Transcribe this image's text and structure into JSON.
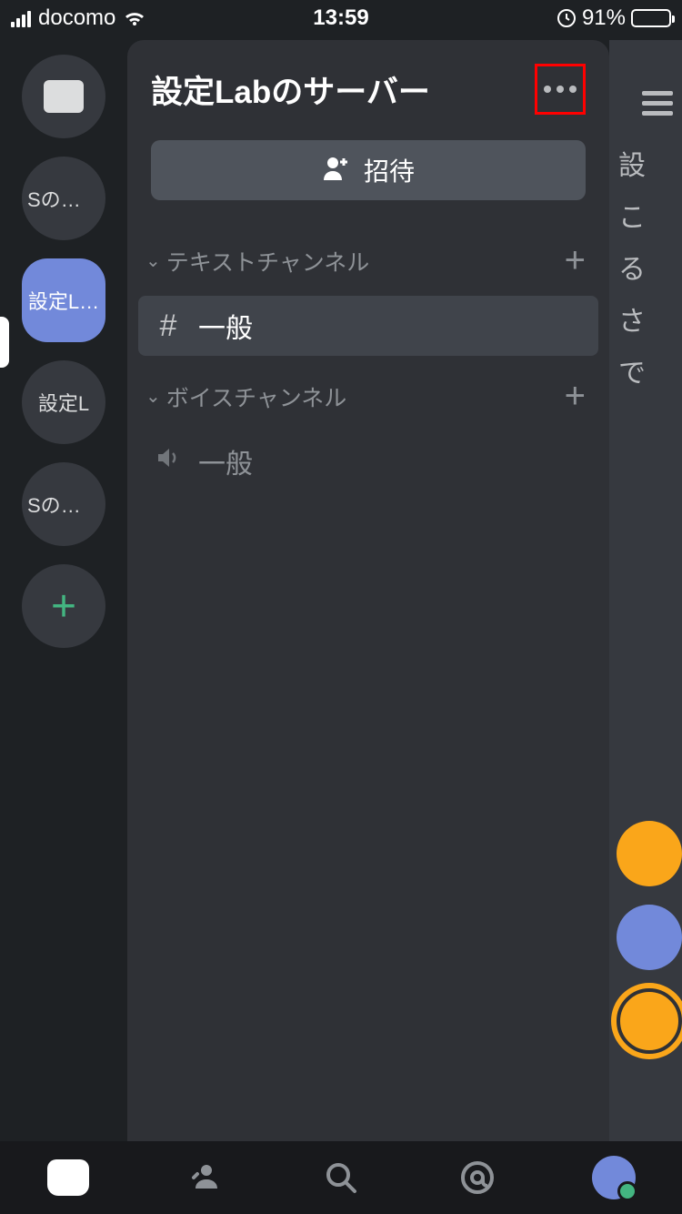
{
  "status_bar": {
    "carrier": "docomo",
    "time": "13:59",
    "battery_pct": "91%"
  },
  "server_rail": {
    "items": [
      {
        "type": "dm"
      },
      {
        "type": "server",
        "label": "Sのサ…"
      },
      {
        "type": "server",
        "label": "設定L…",
        "active": true
      },
      {
        "type": "server",
        "label": "設定L"
      },
      {
        "type": "server",
        "label": "Sのサ…"
      },
      {
        "type": "add"
      }
    ]
  },
  "server": {
    "title": "設定Labのサーバー",
    "invite_label": "招待",
    "categories": [
      {
        "name": "テキストチャンネル",
        "channels": [
          {
            "name": "一般",
            "kind": "text",
            "selected": true
          }
        ]
      },
      {
        "name": "ボイスチャンネル",
        "channels": [
          {
            "name": "一般",
            "kind": "voice",
            "selected": false
          }
        ]
      }
    ]
  },
  "sliver": {
    "lines": "設\nこ\nる\nさ\nで"
  }
}
